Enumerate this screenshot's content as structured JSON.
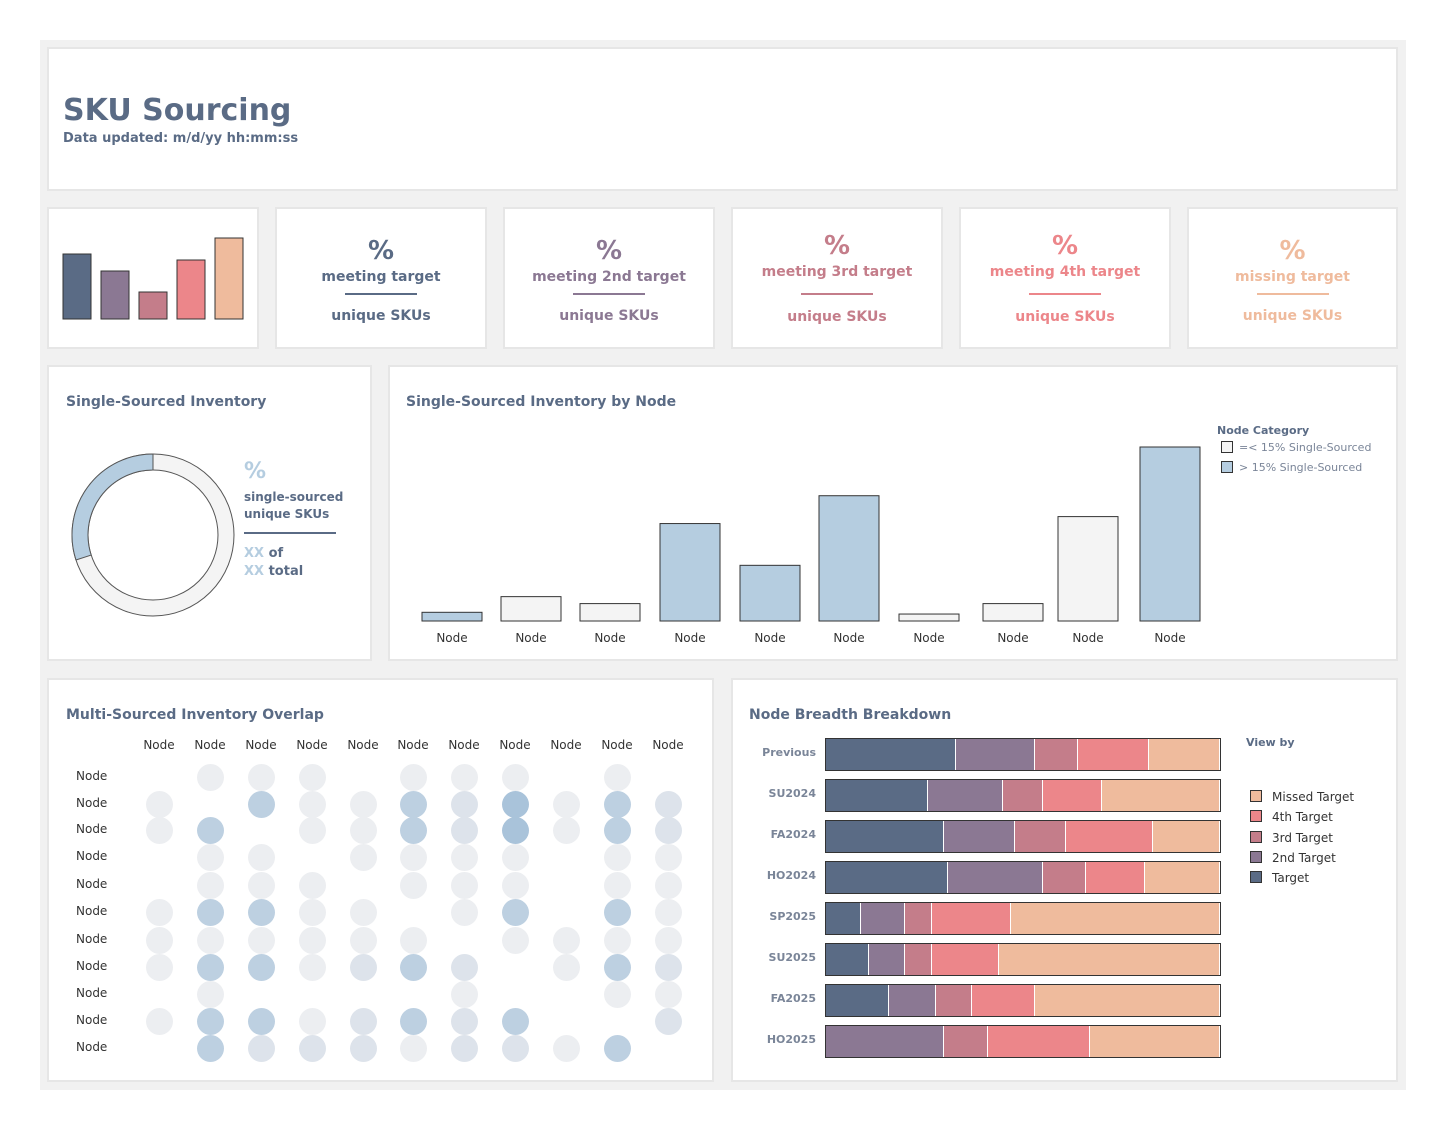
{
  "header": {
    "title": "SKU Sourcing",
    "updated": "Data updated: m/d/yy hh:mm:ss"
  },
  "colors": {
    "target": "#5a6b85",
    "second": "#8b7893",
    "third": "#c47d8a",
    "fourth": "#ec868a",
    "missed": "#efbb9d",
    "single": "#b5cde0",
    "light": "#f4f4f4"
  },
  "mini_chart": {
    "values": [
      65,
      48,
      27,
      59,
      81
    ]
  },
  "kpis": [
    {
      "pct": "%",
      "label": "meeting target",
      "sub": "unique SKUs"
    },
    {
      "pct": "%",
      "label": "meeting 2nd target",
      "sub": "unique SKUs"
    },
    {
      "pct": "%",
      "label": "meeting 3rd target",
      "sub": "unique SKUs"
    },
    {
      "pct": "%",
      "label": "meeting 4th target",
      "sub": "unique SKUs"
    },
    {
      "pct": "%",
      "label": "missing target",
      "sub": "unique SKUs"
    }
  ],
  "single_sourced": {
    "title": "Single-Sourced Inventory",
    "pct": "%",
    "label1": "single-sourced",
    "label2": "unique SKUs",
    "count_placeholder": "XX",
    "count_suffix": "of",
    "total_placeholder": "XX",
    "total_suffix": "total",
    "share": 0.3
  },
  "by_node": {
    "title": "Single-Sourced Inventory by Node",
    "legend_title": "Node Category",
    "legend_items": [
      "=< 15% Single-Sourced",
      "> 15% Single-Sourced"
    ],
    "chart_data": {
      "type": "bar",
      "categories": [
        "Node",
        "Node",
        "Node",
        "Node",
        "Node",
        "Node",
        "Node",
        "Node",
        "Node",
        "Node"
      ],
      "values": [
        5,
        14,
        10,
        56,
        32,
        72,
        4,
        10,
        60,
        100
      ],
      "category": [
        "high",
        "low",
        "low",
        "high",
        "high",
        "high",
        "low",
        "low",
        "low",
        "high"
      ]
    }
  },
  "overlap": {
    "title": "Multi-Sourced Inventory Overlap",
    "columns": [
      "Node",
      "Node",
      "Node",
      "Node",
      "Node",
      "Node",
      "Node",
      "Node",
      "Node",
      "Node",
      "Node"
    ],
    "rows": [
      "Node",
      "Node",
      "Node",
      "Node",
      "Node",
      "Node",
      "Node",
      "Node",
      "Node",
      "Node",
      "Node"
    ],
    "matrix": [
      [
        0,
        0,
        1,
        1,
        1,
        0,
        1,
        1,
        1,
        0,
        1,
        0
      ],
      [
        0,
        1,
        0,
        3,
        1,
        1,
        3,
        2,
        4,
        1,
        3,
        2
      ],
      [
        0,
        1,
        3,
        0,
        1,
        1,
        3,
        2,
        4,
        1,
        3,
        2
      ],
      [
        0,
        0,
        1,
        1,
        0,
        1,
        1,
        1,
        1,
        0,
        1,
        1
      ],
      [
        0,
        0,
        1,
        1,
        1,
        0,
        1,
        1,
        1,
        0,
        1,
        1
      ],
      [
        0,
        1,
        3,
        3,
        1,
        1,
        0,
        1,
        3,
        0,
        3,
        1
      ],
      [
        0,
        1,
        1,
        1,
        1,
        1,
        1,
        0,
        1,
        1,
        1,
        1
      ],
      [
        0,
        1,
        3,
        3,
        1,
        2,
        3,
        2,
        0,
        1,
        3,
        2
      ],
      [
        0,
        0,
        1,
        0,
        0,
        0,
        0,
        1,
        0,
        0,
        1,
        1
      ],
      [
        0,
        1,
        3,
        3,
        1,
        2,
        3,
        2,
        3,
        0,
        0,
        2
      ],
      [
        0,
        0,
        3,
        2,
        2,
        2,
        1,
        2,
        2,
        1,
        3,
        0
      ]
    ]
  },
  "breadth": {
    "title": "Node Breadth Breakdown",
    "view_by": "View by",
    "legend": [
      "Missed Target",
      "4th Target",
      "3rd Target",
      "2nd Target",
      "Target"
    ],
    "chart_data": {
      "type": "bar",
      "orientation": "horizontal",
      "stacked": true,
      "categories": [
        "Previous",
        "SU2024",
        "FA2024",
        "HO2024",
        "SP2025",
        "SU2025",
        "FA2025",
        "HO2025"
      ],
      "series": [
        {
          "name": "Target",
          "values": [
            33,
            26,
            30,
            31,
            9,
            11,
            16,
            0
          ]
        },
        {
          "name": "2nd Target",
          "values": [
            20,
            19,
            18,
            24,
            11,
            9,
            12,
            30
          ]
        },
        {
          "name": "3rd Target",
          "values": [
            11,
            10,
            13,
            11,
            7,
            7,
            9,
            11
          ]
        },
        {
          "name": "4th Target",
          "values": [
            18,
            15,
            22,
            15,
            20,
            17,
            16,
            26
          ]
        },
        {
          "name": "Missed Target",
          "values": [
            18,
            30,
            17,
            19,
            53,
            56,
            47,
            33
          ]
        }
      ]
    }
  }
}
